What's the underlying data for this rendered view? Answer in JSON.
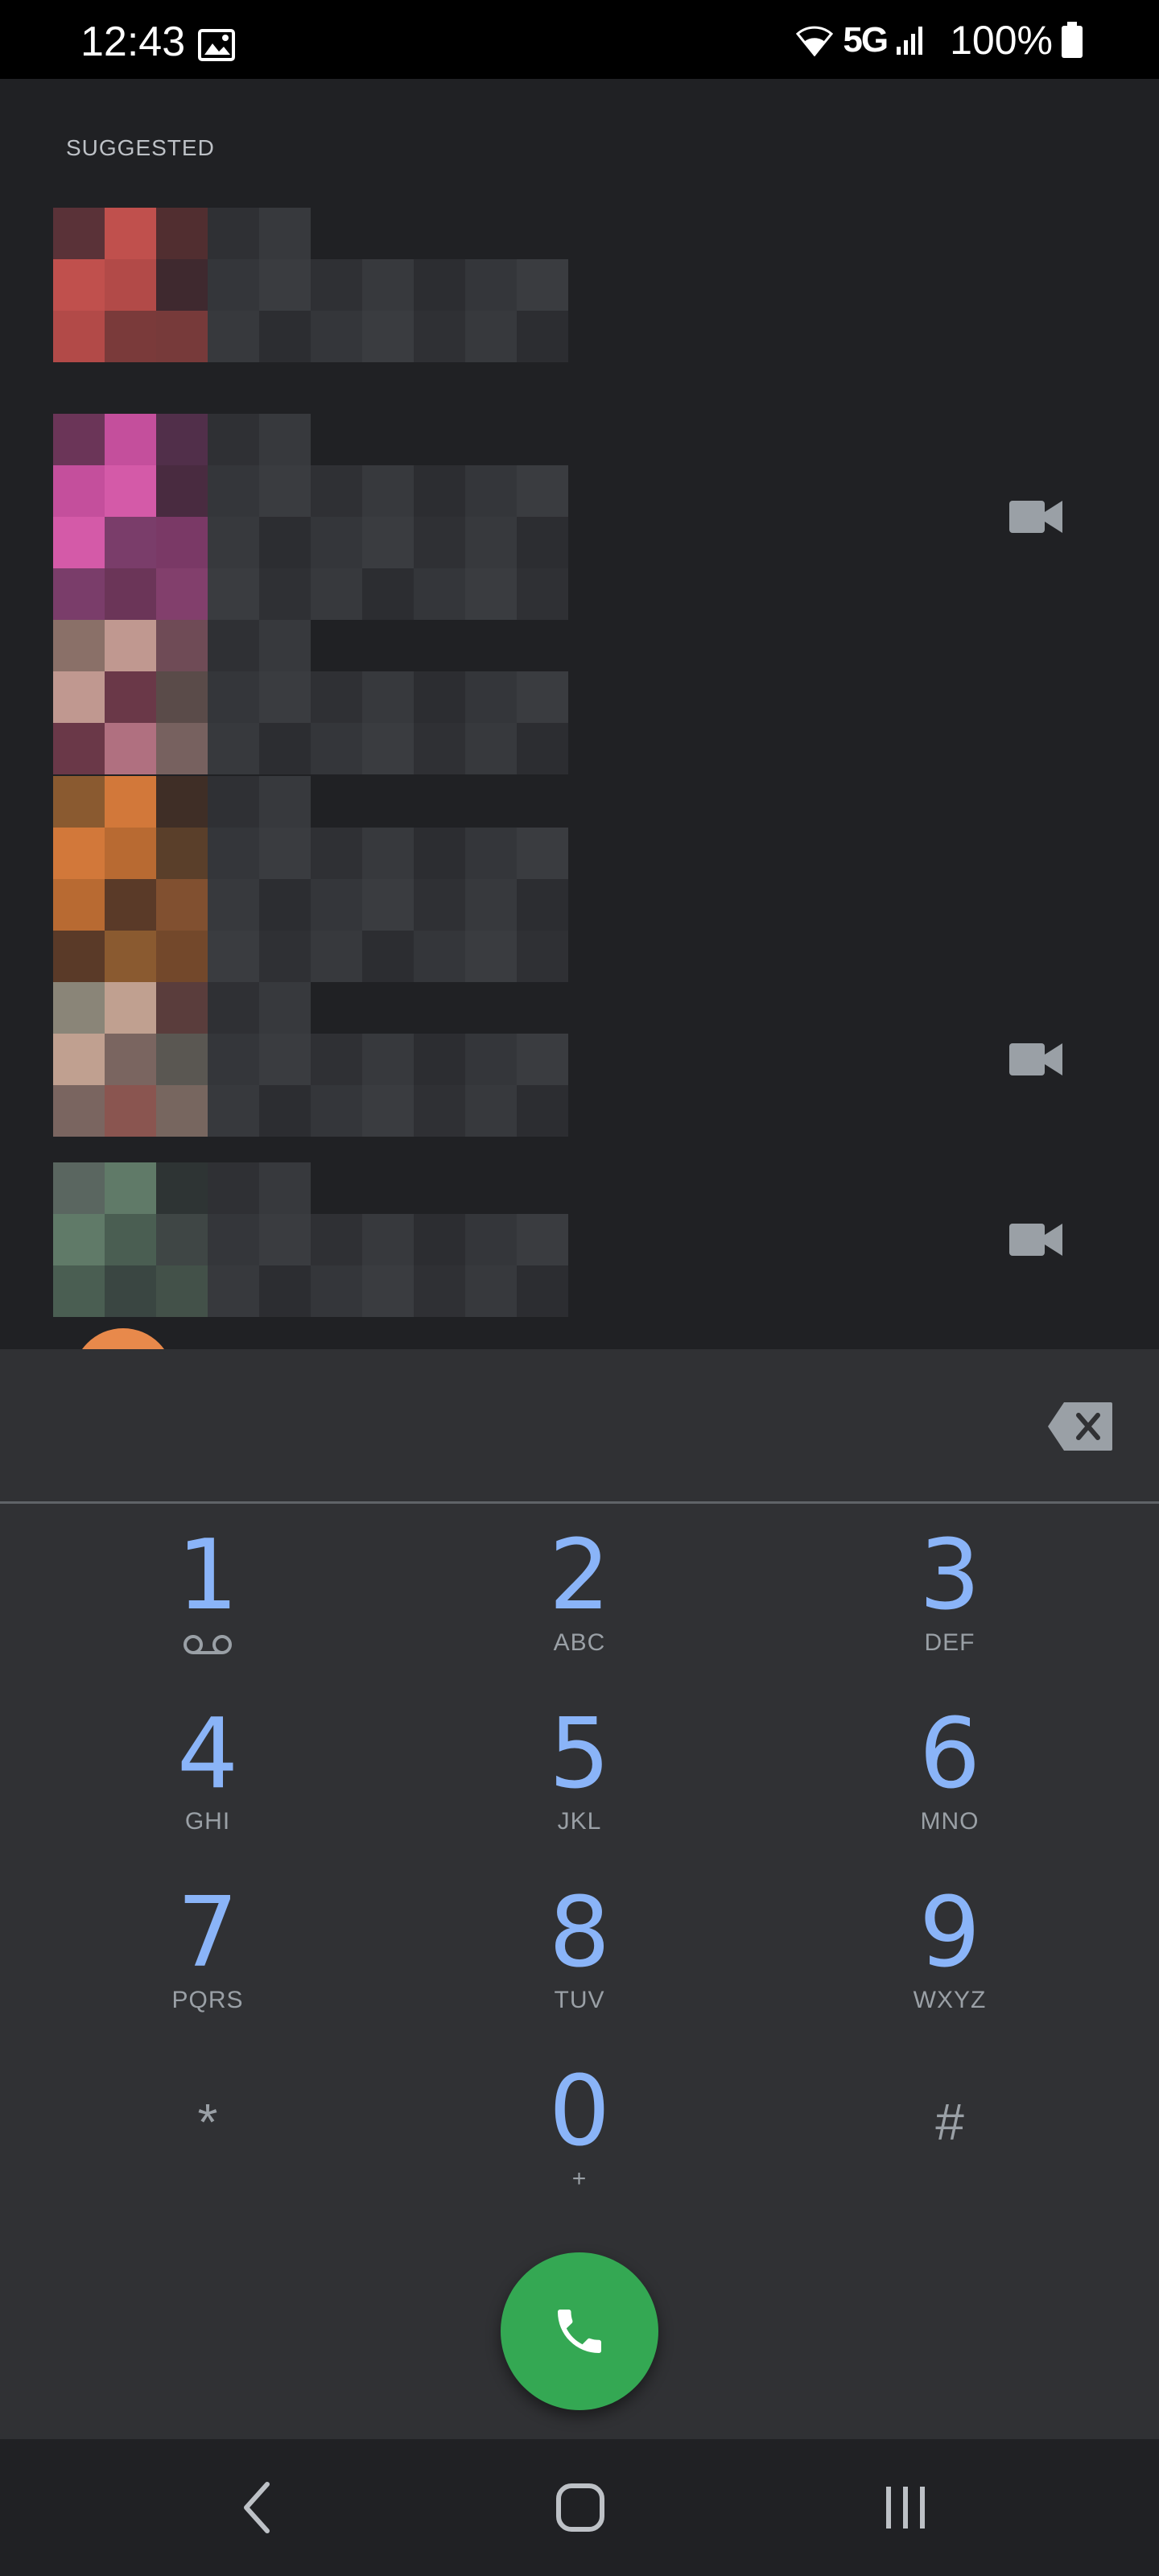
{
  "status_bar": {
    "time": "12:43",
    "network": "5G",
    "battery": "100%"
  },
  "suggested": {
    "label": "SUGGESTED",
    "contacts": [
      {
        "has_video": false
      },
      {
        "has_video": true
      },
      {
        "has_video": false
      },
      {
        "has_video": false
      },
      {
        "has_video": true
      },
      {
        "has_video": true
      }
    ]
  },
  "dialpad": {
    "keys": [
      {
        "digit": "1",
        "letters": ""
      },
      {
        "digit": "2",
        "letters": "ABC"
      },
      {
        "digit": "3",
        "letters": "DEF"
      },
      {
        "digit": "4",
        "letters": "GHI"
      },
      {
        "digit": "5",
        "letters": "JKL"
      },
      {
        "digit": "6",
        "letters": "MNO"
      },
      {
        "digit": "7",
        "letters": "PQRS"
      },
      {
        "digit": "8",
        "letters": "TUV"
      },
      {
        "digit": "9",
        "letters": "WXYZ"
      },
      {
        "digit": "*",
        "letters": ""
      },
      {
        "digit": "0",
        "letters": "+"
      },
      {
        "digit": "#",
        "letters": ""
      }
    ]
  },
  "colors": {
    "accent_digit": "#8ab4f8",
    "call_button": "#34a853",
    "background": "#202124",
    "sheet": "#303134"
  },
  "icons": {
    "backspace": "backspace-icon",
    "call": "phone-icon",
    "video": "videocam-icon",
    "voicemail": "voicemail-icon",
    "nav_back": "back-icon",
    "nav_home": "home-icon",
    "nav_recents": "recents-icon"
  }
}
